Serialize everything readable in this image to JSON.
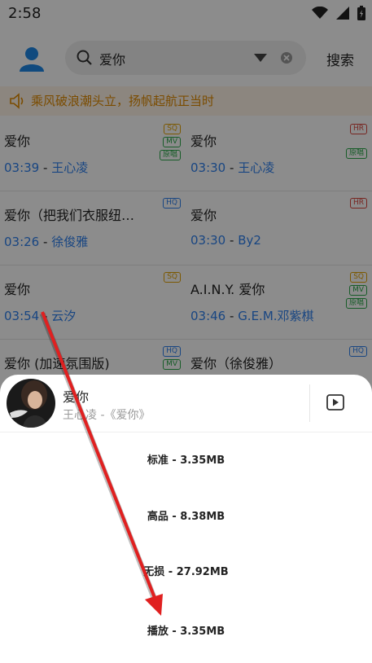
{
  "status": {
    "time": "2:58"
  },
  "search": {
    "query": "爱你",
    "button": "搜索"
  },
  "notice": {
    "text": "乘风破浪潮头立，扬帆起航正当时"
  },
  "songs": [
    {
      "title": "爱你",
      "duration": "03:39",
      "artist": "王心凌",
      "badges": [
        "SQ",
        "MV",
        "原唱"
      ]
    },
    {
      "title": "爱你",
      "duration": "03:30",
      "artist": "王心凌",
      "badges": [
        "HR",
        "原唱"
      ]
    },
    {
      "title": "爱你（把我们衣服纽…",
      "duration": "03:26",
      "artist": "徐俊雅",
      "badges": [
        "HQ"
      ]
    },
    {
      "title": "爱你",
      "duration": "03:30",
      "artist": "By2",
      "badges": [
        "HR"
      ]
    },
    {
      "title": "爱你",
      "duration": "03:54",
      "artist": "云汐",
      "badges": [
        "SQ"
      ]
    },
    {
      "title": "A.I.N.Y. 爱你",
      "duration": "03:46",
      "artist": "G.E.M.邓紫棋",
      "badges": [
        "SQ",
        "MV",
        "原唱"
      ]
    },
    {
      "title": "爱你 (加速氛围版)",
      "duration": "",
      "artist": "",
      "badges": [
        "HQ",
        "MV"
      ]
    },
    {
      "title": "爱你（徐俊雅）",
      "duration": "",
      "artist": "",
      "badges": [
        "HQ"
      ]
    }
  ],
  "meta_sep": " - ",
  "sheet": {
    "title": "爱你",
    "subtitle": "王心凌 -《爱你》",
    "options": [
      "标准 - 3.35MB",
      "高品 - 8.38MB",
      "无损 - 27.92MB",
      "播放 - 3.35MB"
    ]
  },
  "colors": {
    "accent": "#2f80ed",
    "notice": "#e08a00",
    "arrow": "#e02020"
  }
}
